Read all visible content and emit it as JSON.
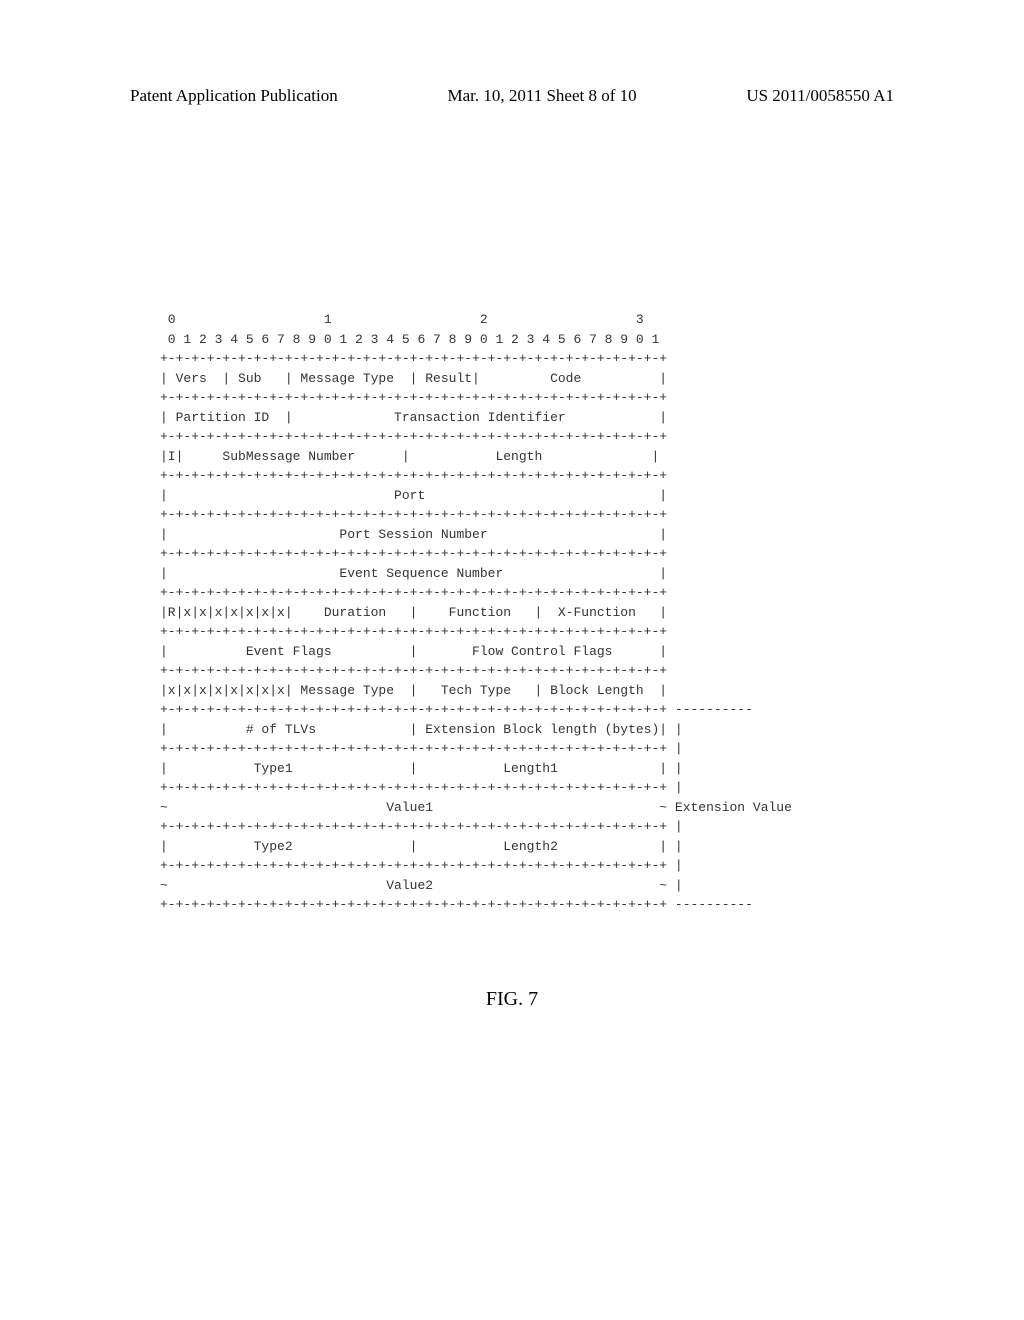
{
  "header": {
    "left": "Patent Application Publication",
    "center": "Mar. 10, 2011  Sheet 8 of 10",
    "right": "US 2011/0058550 A1"
  },
  "diagram": {
    "bit_line1": " 0                   1                   2                   3",
    "bit_line2": " 0 1 2 3 4 5 6 7 8 9 0 1 2 3 4 5 6 7 8 9 0 1 2 3 4 5 6 7 8 9 0 1",
    "sep": "+-+-+-+-+-+-+-+-+-+-+-+-+-+-+-+-+-+-+-+-+-+-+-+-+-+-+-+-+-+-+-+-+",
    "row1": "| Vers  | Sub   | Message Type  | Result|         Code          |",
    "row2": "| Partition ID  |             Transaction Identifier            |",
    "row3": "|I|     SubMessage Number      |           Length              |",
    "row4": "|                             Port                              |",
    "row5": "|                      Port Session Number                      |",
    "row6": "|                      Event Sequence Number                    |",
    "row7": "|R|x|x|x|x|x|x|x|    Duration   |    Function   |  X-Function   |",
    "row8": "|          Event Flags          |       Flow Control Flags      |",
    "row9": "|x|x|x|x|x|x|x|x| Message Type  |   Tech Type   | Block Length  |",
    "row10": "|          # of TLVs            | Extension Block length (bytes)|",
    "row11": "|           Type1               |           Length1             |",
    "row12": "~                            Value1                             ~",
    "row13": "|           Type2               |           Length2             |",
    "row14": "~                            Value2                             ~",
    "ext_dash": " ----------",
    "ext_pipe": " |",
    "ext_label": " Extension Value"
  },
  "figure_label": "FIG. 7"
}
